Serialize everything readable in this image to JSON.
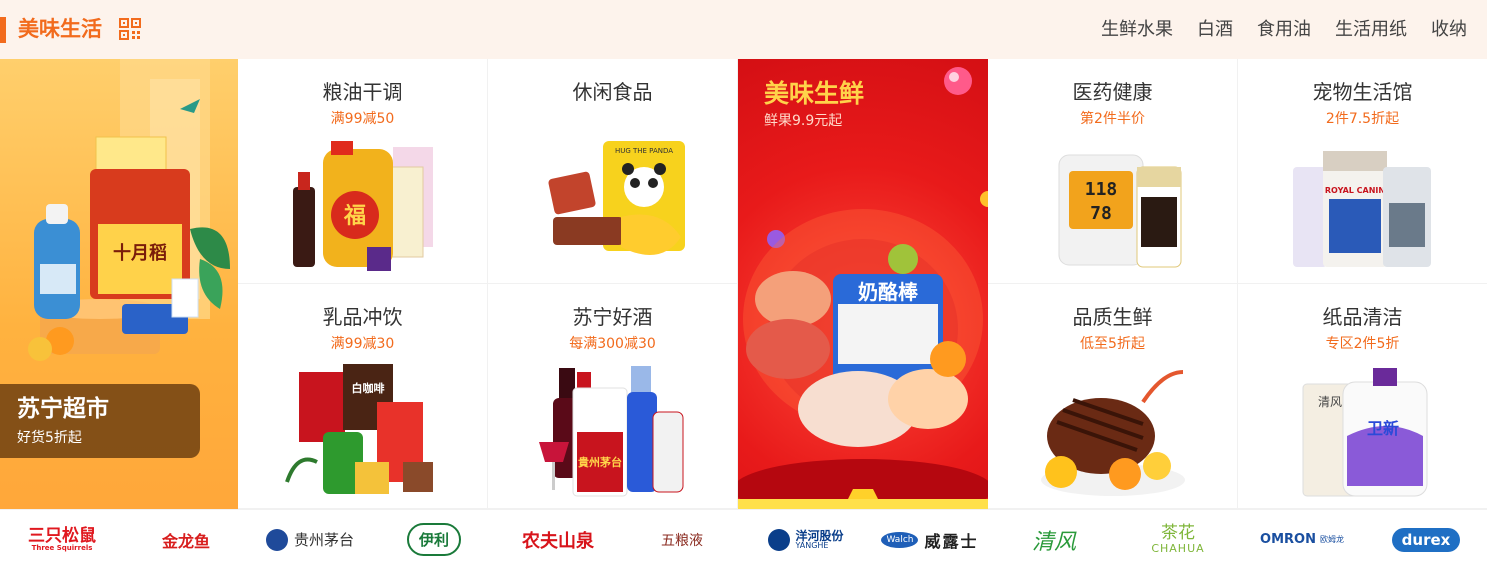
{
  "header": {
    "title": "美味生活",
    "qr_icon": "qr-code-icon",
    "nav": [
      "生鲜水果",
      "白酒",
      "食用油",
      "生活用纸",
      "收纳"
    ]
  },
  "promo_left": {
    "title": "苏宁超市",
    "subtitle": "好货5折起"
  },
  "categories": {
    "c1": {
      "name": "粮油干调",
      "offer": "满99减50"
    },
    "c2": {
      "name": "休闲食品",
      "offer": ""
    },
    "c3": {
      "name": "医药健康",
      "offer": "第2件半价"
    },
    "c4": {
      "name": "宠物生活馆",
      "offer": "2件7.5折起"
    },
    "c5": {
      "name": "乳品冲饮",
      "offer": "满99减30"
    },
    "c6": {
      "name": "苏宁好酒",
      "offer": "每满300减30"
    },
    "c7": {
      "name": "品质生鲜",
      "offer": "低至5折起"
    },
    "c8": {
      "name": "纸品清洁",
      "offer": "专区2件5折"
    }
  },
  "promo_fresh": {
    "title": "美味生鲜",
    "subtitle": "鲜果9.9元起",
    "package_text": "奶酪棒"
  },
  "product_text": {
    "oil_brand": "福",
    "rice_brand": "十月稻",
    "panda_bag": "HUG THE PANDA",
    "coffee_brand": "白咖啡",
    "moutai": "貴州茅台",
    "bp_reading_1": "118",
    "bp_reading_2": "78",
    "pet_brand": "ROYAL CANIN",
    "detergent": "卫新",
    "tissue": "清风"
  },
  "brands": [
    {
      "name": "三只松鼠",
      "sub": "Three Squirrels",
      "color": "#e0181f"
    },
    {
      "name": "金龙鱼",
      "sub": "",
      "color": "#d81e1e"
    },
    {
      "name": "贵州茅台",
      "sub": "",
      "color": "#333333"
    },
    {
      "name": "伊利",
      "sub": "",
      "color": "#1a7a3a"
    },
    {
      "name": "农夫山泉",
      "sub": "",
      "color": "#d8141b"
    },
    {
      "name": "五粮液",
      "sub": "",
      "color": "#8a2a1f"
    },
    {
      "name": "洋河股份",
      "sub": "YANGHE",
      "color": "#0a3e8a"
    },
    {
      "name": "威露士",
      "sub": "Walch",
      "color": "#222222"
    },
    {
      "name": "清风",
      "sub": "",
      "color": "#2a9a3a"
    },
    {
      "name": "茶花",
      "sub": "CHAHUA",
      "color": "#7fb63a"
    },
    {
      "name": "OMRON",
      "sub": "欧姆龙",
      "color": "#1a4fa0"
    },
    {
      "name": "durex",
      "sub": "",
      "color": "#1f6fc4"
    }
  ]
}
